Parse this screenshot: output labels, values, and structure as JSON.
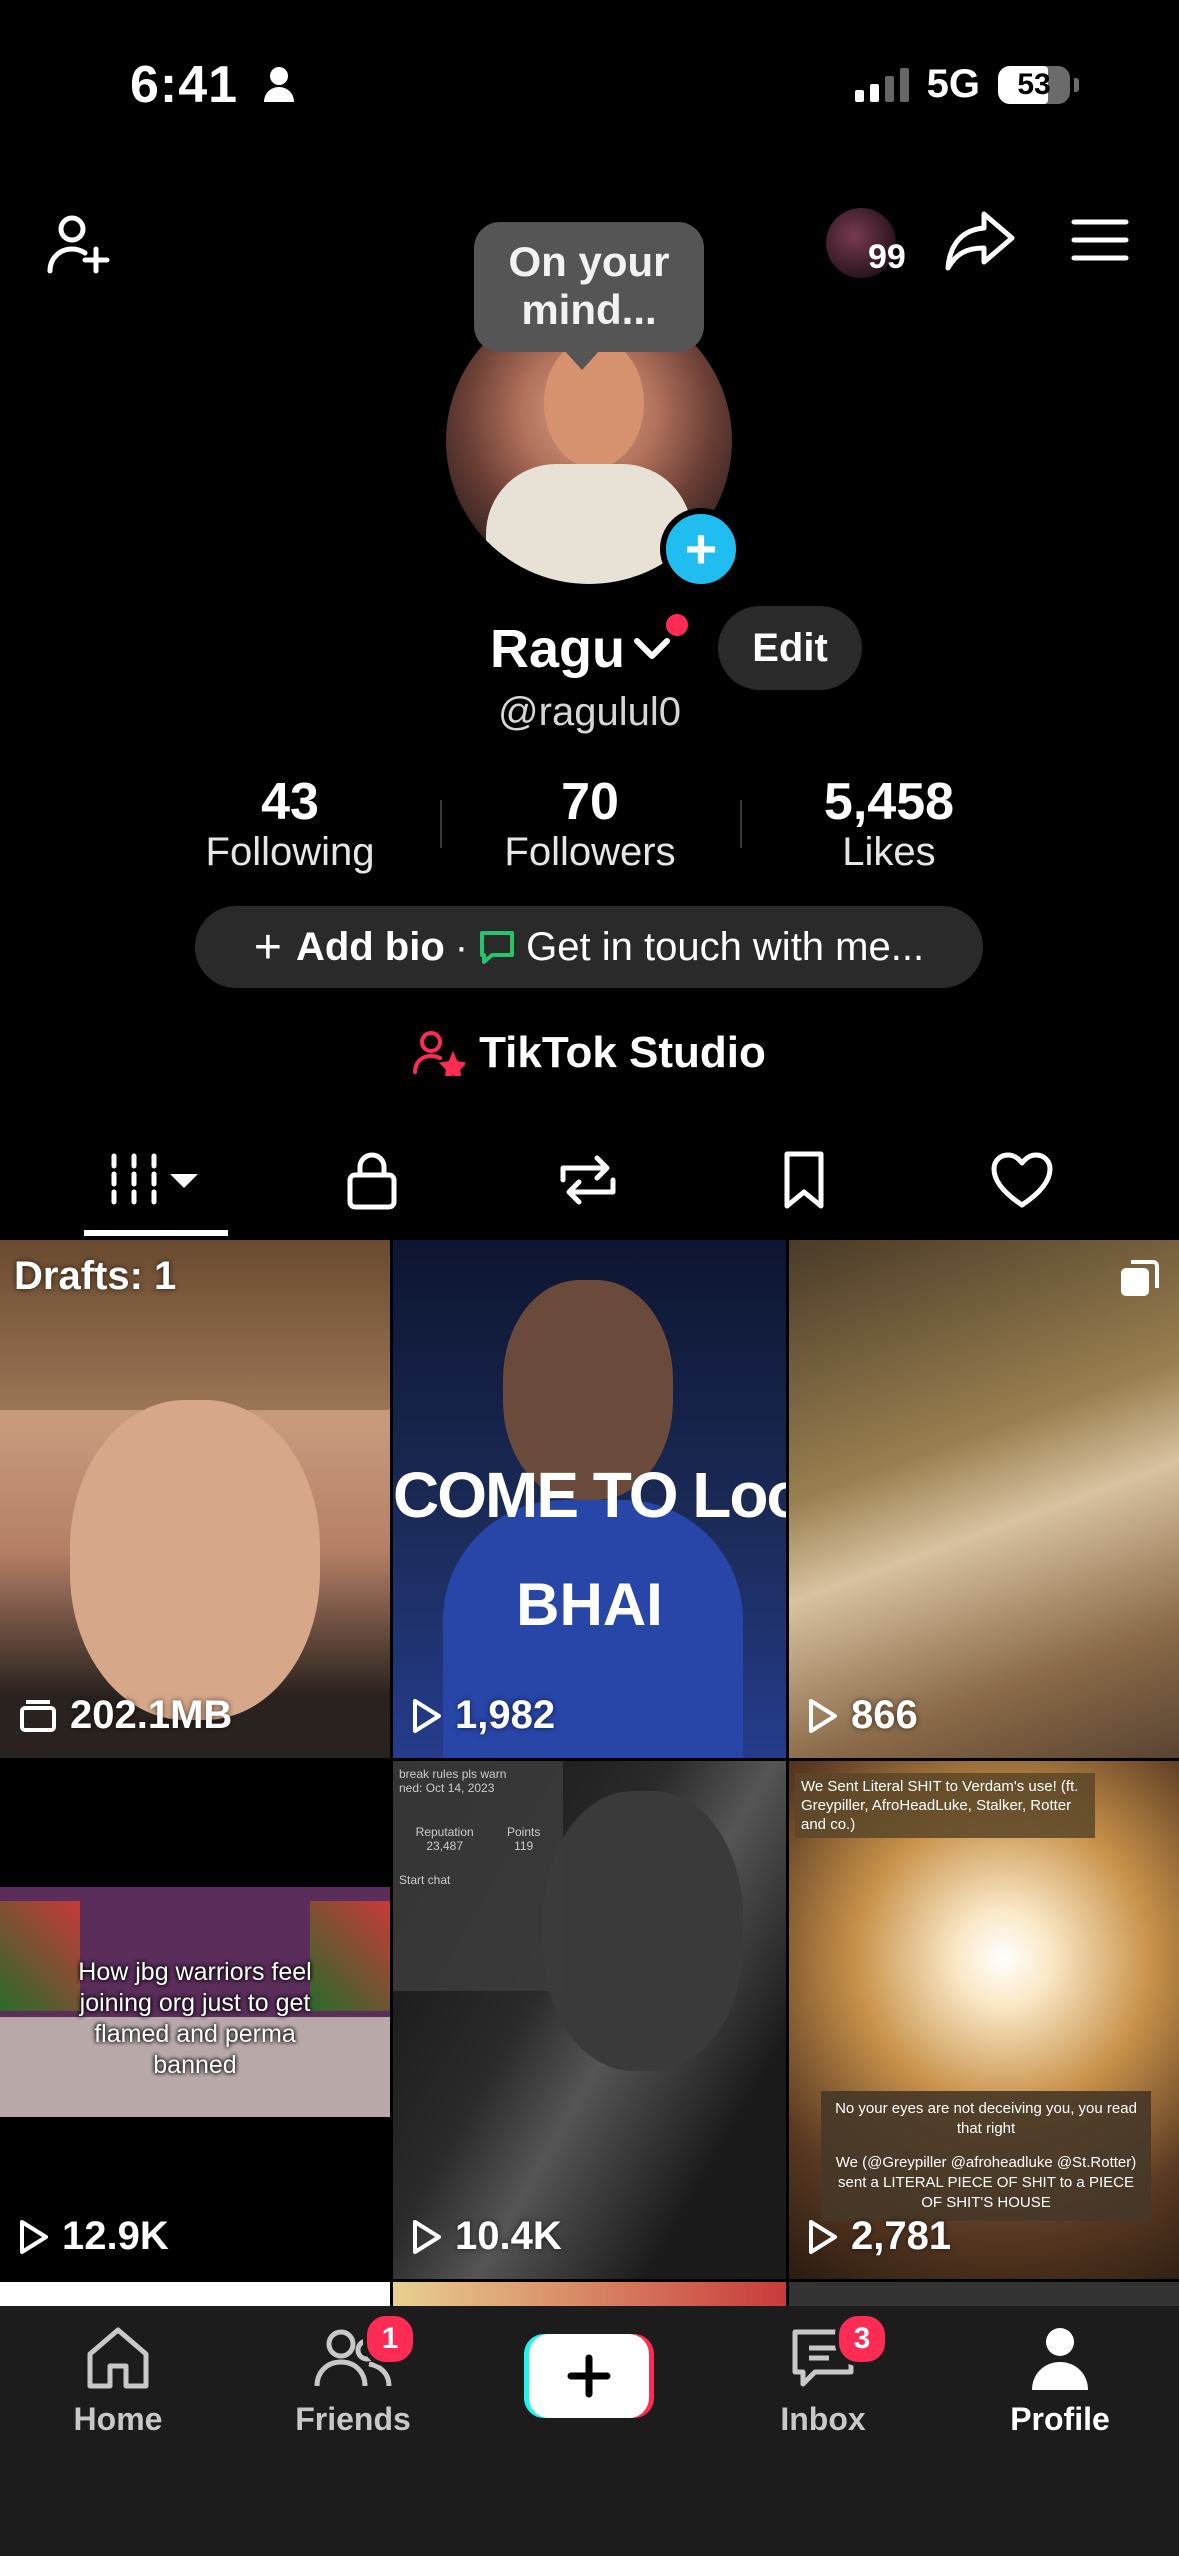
{
  "status": {
    "time": "6:41",
    "network": "5G",
    "battery": "53"
  },
  "header": {
    "notification_count": "99"
  },
  "profile": {
    "tooltip_line1": "On your",
    "tooltip_line2": "mind...",
    "name": "Ragu",
    "handle": "@ragulul0",
    "edit_label": "Edit"
  },
  "stats": [
    {
      "value": "43",
      "label": "Following"
    },
    {
      "value": "70",
      "label": "Followers"
    },
    {
      "value": "5,458",
      "label": "Likes"
    }
  ],
  "bio": {
    "add_label": "Add bio",
    "separator": "·",
    "contact_label": "Get in touch with me..."
  },
  "studio": {
    "label": "TikTok Studio"
  },
  "grid": [
    {
      "top_label": "Drafts: 1",
      "count": "202.1MB"
    },
    {
      "overlay_top": "COME TO Looksm",
      "overlay_bottom": "BHAI",
      "count": "1,982"
    },
    {
      "count": "866"
    },
    {
      "caption": "How jbg warriors feel joining org just to get flamed and perma banned",
      "count": "12.9K"
    },
    {
      "doc_line1": "break rules pls warn",
      "doc_line2": "ned: Oct 14, 2023",
      "doc_col1": "Reputation",
      "doc_val1": "23,487",
      "doc_col2": "Points",
      "doc_val2": "119",
      "doc_chat": "Start chat",
      "count": "10.4K"
    },
    {
      "headline": "We Sent Literal SHIT to Verdam's use! (ft. Greypiller, AfroHeadLuke, Stalker, Rotter and co.)",
      "caption1": "No your eyes are not deceiving you, you read that right",
      "caption2": "We (@Greypiller @afroheadluke @St.Rotter) sent a LITERAL PIECE OF SHIT to a PIECE OF SHIT'S HOUSE",
      "count": "2,781"
    }
  ],
  "nav": {
    "home": "Home",
    "friends": "Friends",
    "friends_badge": "1",
    "inbox": "Inbox",
    "inbox_badge": "3",
    "profile": "Profile"
  }
}
